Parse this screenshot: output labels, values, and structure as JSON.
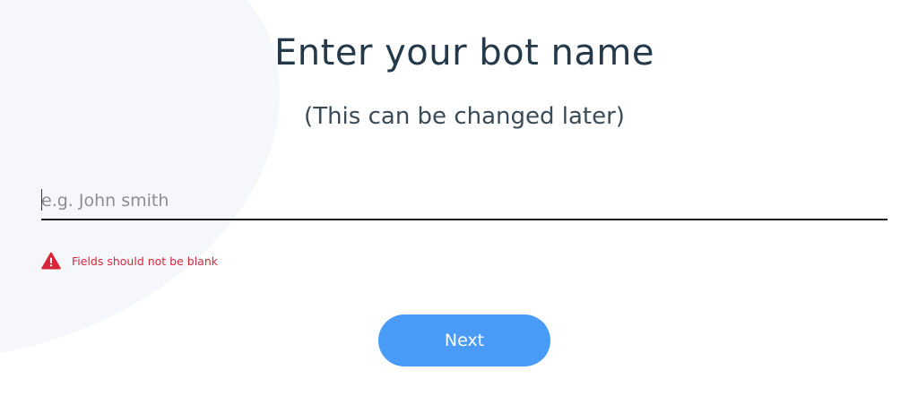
{
  "page": {
    "title": "Enter your bot name",
    "subtitle": "(This can be changed later)"
  },
  "bot_name_field": {
    "value": "",
    "placeholder": "e.g. John smith"
  },
  "validation": {
    "icon": "warning-triangle-icon",
    "message": "Fields should not be blank",
    "color": "#d6263a"
  },
  "next_button": {
    "label": "Next",
    "color": "#4a9bf8"
  }
}
